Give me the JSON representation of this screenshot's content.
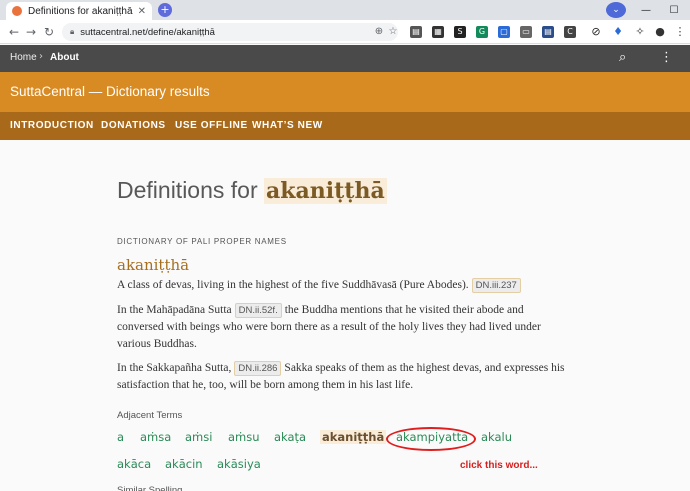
{
  "browser": {
    "tab_title": "Definitions for akaniṭṭhā",
    "tab_close": "✕",
    "new_tab": "+",
    "url": "suttacentral.net/define/akaniṭṭhā",
    "window_controls": {
      "minimize": "—",
      "maximize": "☐"
    }
  },
  "site": {
    "breadcrumb": [
      "Home",
      "About"
    ],
    "breadcrumb_sep": "›",
    "banner_title": "SuttaCentral — Dictionary results",
    "menu": [
      "INTRODUCTION",
      "DONATIONS",
      "USE OFFLINE",
      "WHAT’S NEW"
    ]
  },
  "content": {
    "title_prefix": "Definitions for",
    "title_term": "akaniṭṭhā",
    "dictionary_name": "DICTIONARY OF PALI PROPER NAMES",
    "entry_word": "akaniṭṭhā",
    "p1_text": "A class of devas, living in the highest of the five Suddhāvasā (Pure Abodes).",
    "p1_ref": "DN.iii.237",
    "p2_a": "In the Mahāpadāna Sutta",
    "p2_ref": "DN.ii.52f.",
    "p2_b": "the Buddha mentions that he visited their abode and conversed with beings who were born there as a result of the holy lives they had lived under various Buddhas.",
    "p3_a": "In the Sakkapañha Sutta,",
    "p3_ref": "DN.ii.286",
    "p3_b": "Sakka speaks of them as the highest devas, and expresses his satisfaction that he, too, will be born among them in his last life.",
    "adjacent_label": "Adjacent Terms",
    "adjacent_terms": [
      "a",
      "aṁsa",
      "aṁsi",
      "aṁsu",
      "akaṭa",
      "akaniṭṭhā",
      "akampiyatta",
      "akalu",
      "akāca",
      "akācin",
      "akāsiya"
    ],
    "annotation": "click this word...",
    "similar_label": "Similar Spelling"
  }
}
